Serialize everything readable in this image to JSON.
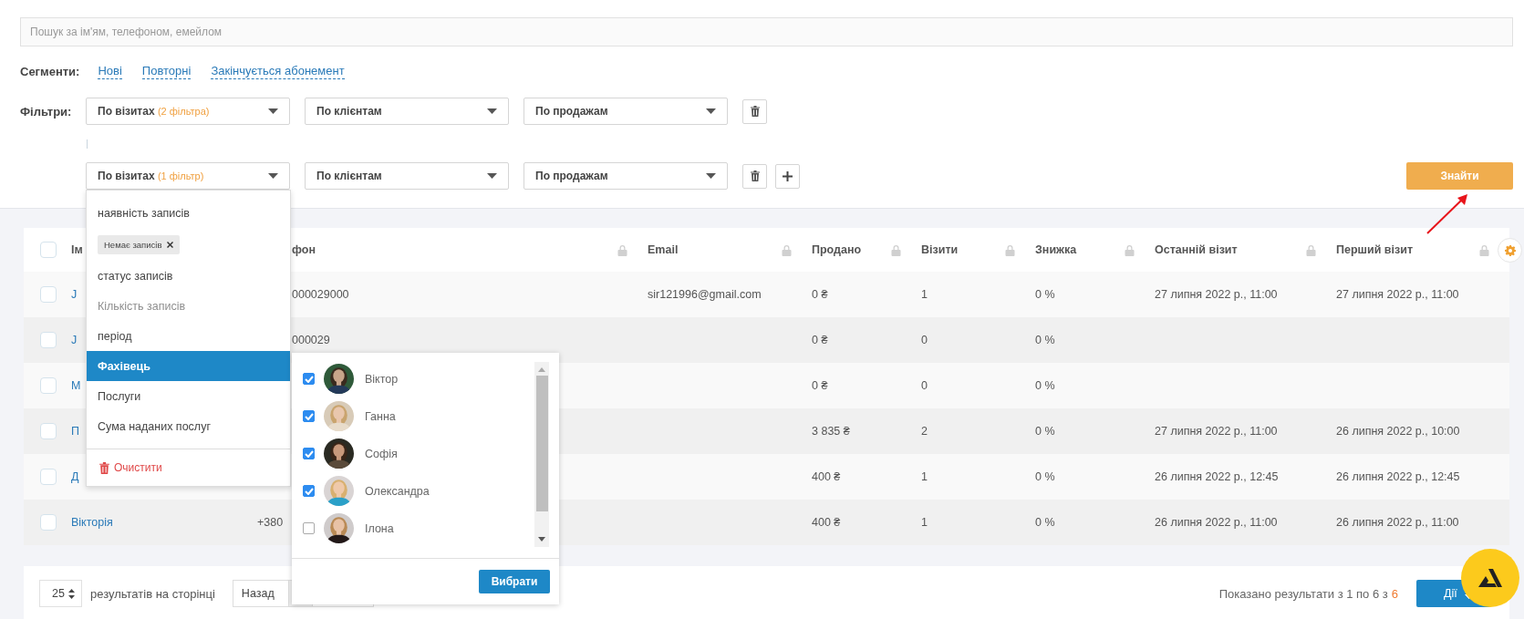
{
  "search": {
    "placeholder": "Пошук за ім'ям, телефоном, емейлом"
  },
  "segments": {
    "label": "Сегменти:",
    "items": [
      "Нові",
      "Повторні",
      "Закінчується абонемент"
    ]
  },
  "filters": {
    "label": "Фільтри:",
    "groups": [
      {
        "selects": [
          {
            "label": "По візитах",
            "note": "(2 фільтра)"
          },
          {
            "label": "По клієнтам"
          },
          {
            "label": "По продажам"
          }
        ],
        "can_add": false
      },
      {
        "selects": [
          {
            "label": "По візитах",
            "note": "(1 фільтр)"
          },
          {
            "label": "По клієнтам"
          },
          {
            "label": "По продажам"
          }
        ],
        "can_add": true
      }
    ]
  },
  "find_button": "Знайти",
  "table": {
    "all_checked": false,
    "columns": [
      {
        "label": "Ім"
      },
      {
        "label": "фон"
      },
      {
        "label": "Email"
      },
      {
        "label": "Продано"
      },
      {
        "label": "Візити"
      },
      {
        "label": "Знижка"
      },
      {
        "label": "Останній візит"
      },
      {
        "label": "Перший візит"
      }
    ],
    "rows": [
      {
        "checked": false,
        "name": "J",
        "phone": "000029000",
        "email": "sir121996@gmail.com",
        "sold": "0 ₴",
        "visits": "1",
        "discount": "0 %",
        "last_visit": "27 липня 2022 р., 11:00",
        "first_visit": "27 липня 2022 р., 11:00"
      },
      {
        "checked": false,
        "name": "J",
        "phone": "000029",
        "sold": "0 ₴",
        "visits": "0",
        "discount": "0 %"
      },
      {
        "checked": false,
        "name": "М",
        "sold": "0 ₴",
        "visits": "0",
        "discount": "0 %"
      },
      {
        "checked": false,
        "name": "П",
        "sold": "3 835 ₴",
        "visits": "2",
        "discount": "0 %",
        "last_visit": "27 липня 2022 р., 11:00",
        "first_visit": "26 липня 2022 р., 10:00"
      },
      {
        "checked": false,
        "name": "Д",
        "sold": "400 ₴",
        "visits": "1",
        "discount": "0 %",
        "last_visit": "26 липня 2022 р., 12:45",
        "first_visit": "26 липня 2022 р., 12:45"
      },
      {
        "checked": false,
        "name": "Вікторія",
        "phone": "+380",
        "sold": "400 ₴",
        "visits": "1",
        "discount": "0 %",
        "last_visit": "26 липня 2022 р., 11:00",
        "first_visit": "26 липня 2022 р., 11:00"
      }
    ]
  },
  "filter_menu": {
    "items": [
      {
        "kind": "option",
        "label": "наявність записів",
        "selected": false,
        "disabled": false
      },
      {
        "kind": "chip",
        "label": "Немає записів"
      },
      {
        "kind": "option",
        "label": "статус записів",
        "selected": false,
        "disabled": false
      },
      {
        "kind": "option",
        "label": "Кількість записів",
        "selected": false,
        "disabled": true
      },
      {
        "kind": "option",
        "label": "період",
        "selected": false,
        "disabled": false
      },
      {
        "kind": "option",
        "label": "Фахівець",
        "selected": true,
        "disabled": false
      },
      {
        "kind": "option",
        "label": "Послуги",
        "selected": false,
        "disabled": false
      },
      {
        "kind": "option",
        "label": "Сума наданих послуг",
        "selected": false,
        "disabled": false
      }
    ],
    "clear": "Очистити"
  },
  "specialists": {
    "items": [
      {
        "name": "Віктор",
        "checked": true
      },
      {
        "name": "Ганна",
        "checked": true
      },
      {
        "name": "Софія",
        "checked": true
      },
      {
        "name": "Олександра",
        "checked": true
      },
      {
        "name": "Ілона",
        "checked": false
      }
    ],
    "confirm": "Вибрати"
  },
  "footer": {
    "per_page": "25",
    "per_page_label": "результатів на сторінці",
    "back": "Назад",
    "summary": "Показано результати з 1 по 6 з",
    "total": "6",
    "actions": "Дії"
  }
}
